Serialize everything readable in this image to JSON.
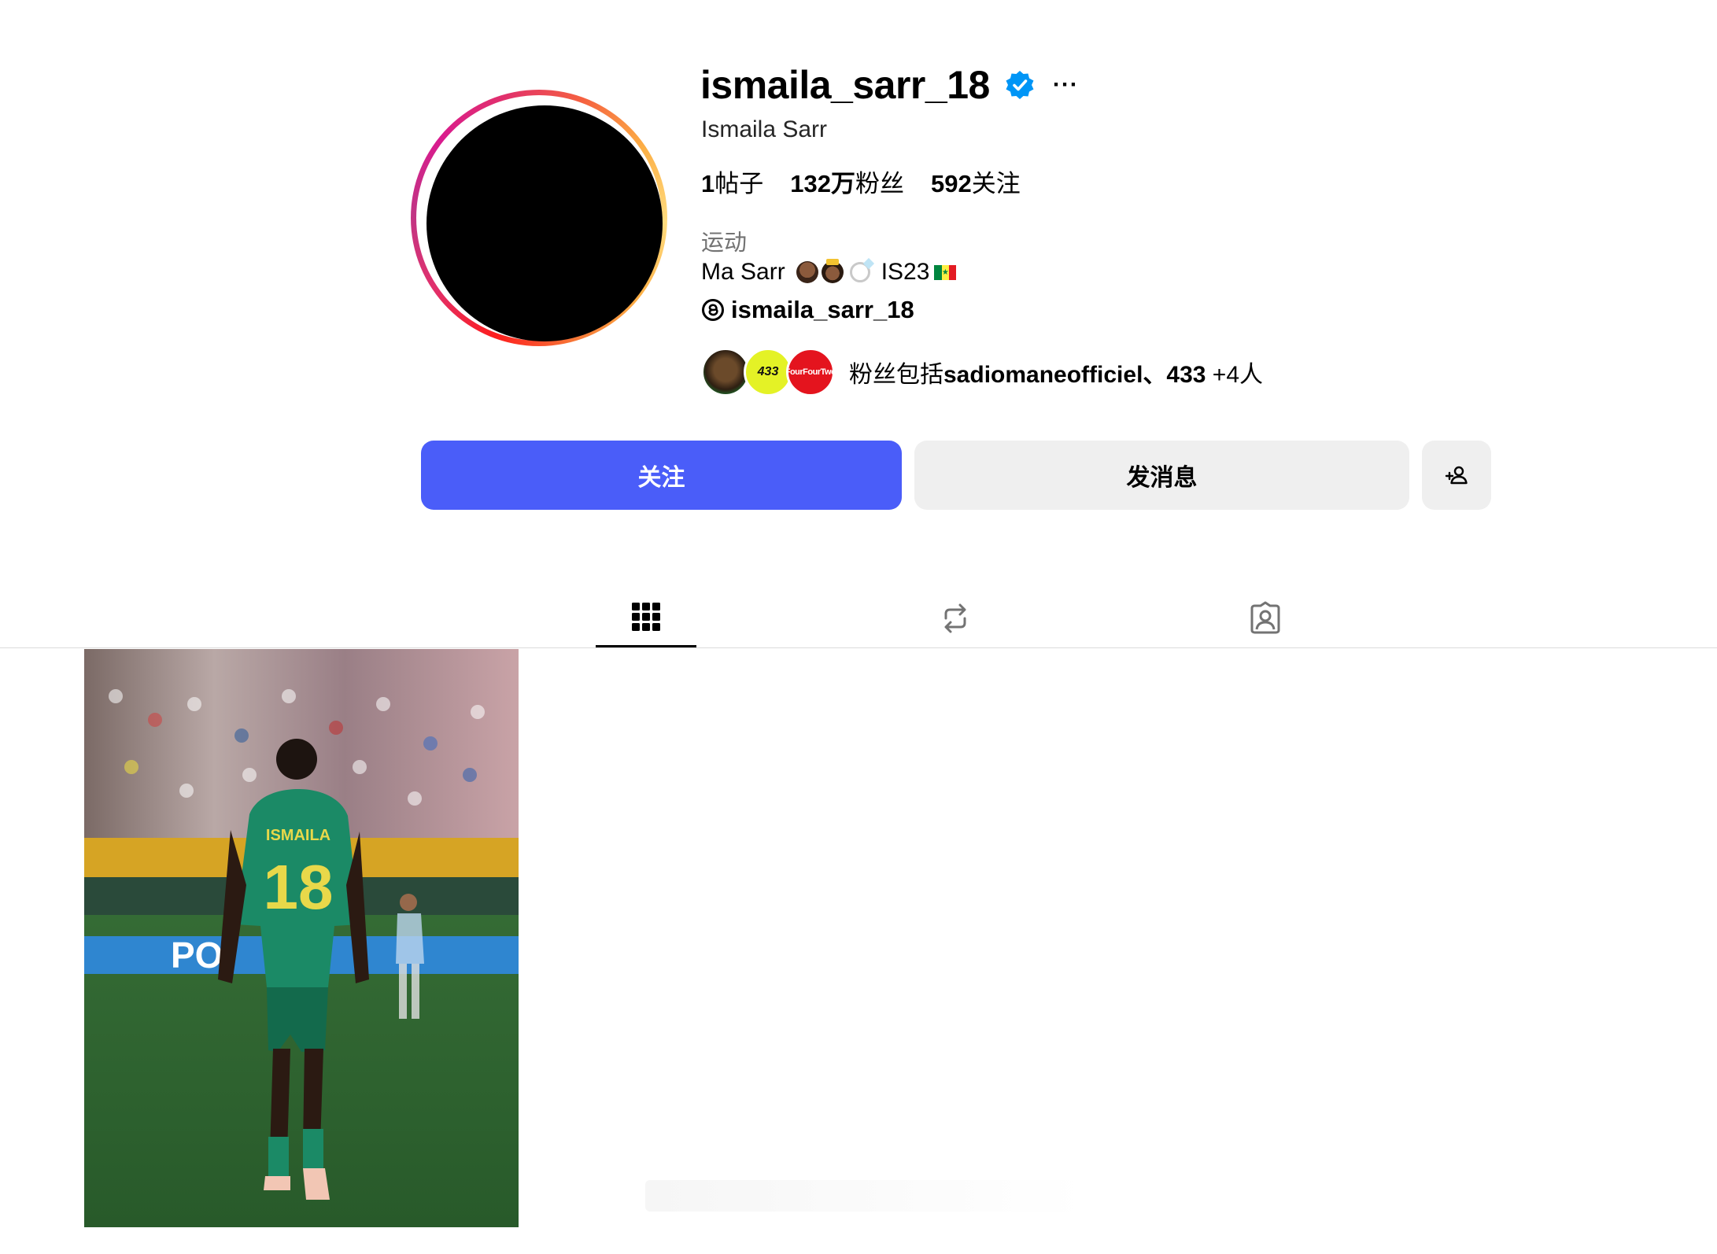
{
  "profile": {
    "username": "ismaila_sarr_18",
    "full_name": "Ismaila Sarr",
    "verified": true,
    "more_label": "···",
    "stats": {
      "posts": "1",
      "posts_label": "帖子",
      "followers": "132万",
      "followers_label": "粉丝",
      "following": "592",
      "following_label": "关注"
    },
    "category": "运动",
    "bio_prefix": "Ma Sarr",
    "bio_suffix": "IS23",
    "threads_handle": "ismaila_sarr_18",
    "followed_by": {
      "prefix": "粉丝包括",
      "names": "sadiomaneofficiel、433",
      "suffix": " +4人",
      "avatar_2_text": "433",
      "avatar_3_text": "FourFourTwo"
    }
  },
  "actions": {
    "follow_label": "关注",
    "message_label": "发消息"
  },
  "tabs": [
    {
      "icon": "grid-icon",
      "active": true
    },
    {
      "icon": "repost-icon",
      "active": false
    },
    {
      "icon": "tagged-icon",
      "active": false
    }
  ],
  "posts": [
    {
      "jersey_name": "ISMAILA",
      "jersey_number": "18",
      "board_text": "PO"
    }
  ],
  "colors": {
    "follow_button": "#4a5df9",
    "secondary_button": "#efefef",
    "verified": "#0095f6",
    "muted_text": "#737373"
  }
}
